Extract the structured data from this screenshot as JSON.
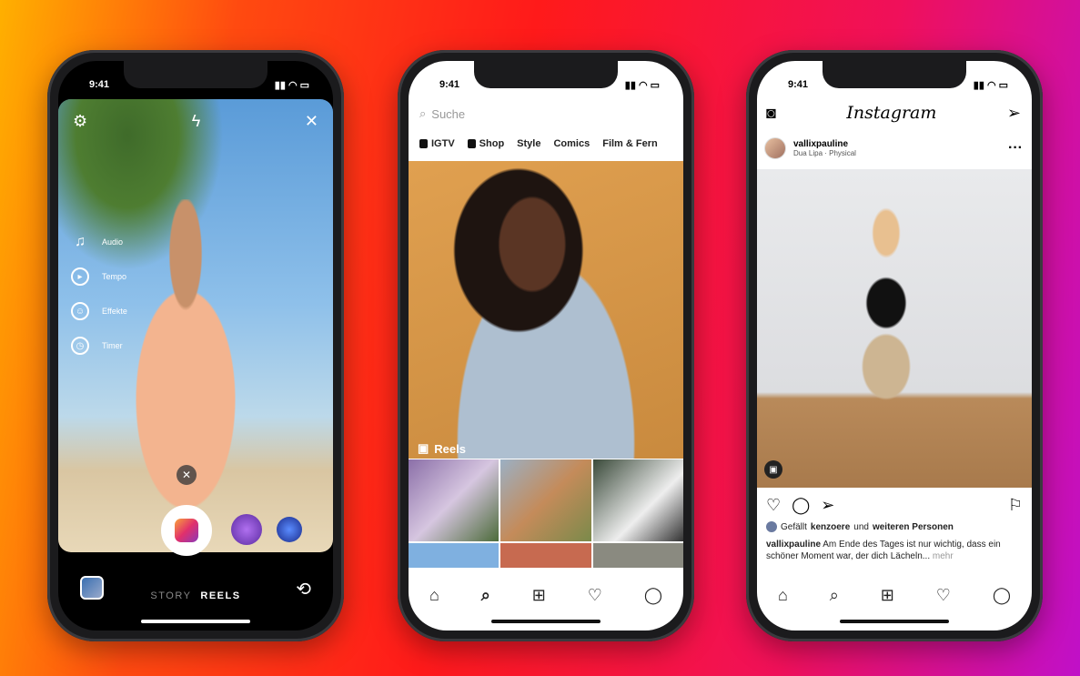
{
  "phones": [
    {
      "time": "9:41",
      "camera": {
        "tools": [
          {
            "icon": "music-note-icon",
            "label": "Audio"
          },
          {
            "icon": "speed-icon",
            "label": "Tempo"
          },
          {
            "icon": "face-effects-icon",
            "label": "Effekte"
          },
          {
            "icon": "timer-icon",
            "label": "Timer"
          }
        ],
        "modes": {
          "story": "STORY",
          "reels": "REELS",
          "active": "REELS"
        }
      }
    },
    {
      "time": "9:41",
      "search_placeholder": "Suche",
      "chips": [
        "IGTV",
        "Shop",
        "Style",
        "Comics",
        "Film & Fern"
      ],
      "reels_label": "Reels"
    },
    {
      "time": "9:41",
      "logo": "Instagram",
      "post": {
        "username": "vallixpauline",
        "audio": "Dua Lipa · Physical",
        "likes_prefix": "Gefällt",
        "likes_user": "kenzoere",
        "likes_mid": "und",
        "likes_suffix": "weiteren Personen",
        "caption_user": "vallixpauline",
        "caption": "Am Ende des Tages ist nur wichtig, dass ein schöner Moment war, der dich Lächeln...",
        "more": "mehr"
      }
    }
  ],
  "colors": {
    "background_start": "#ffb000",
    "background_end": "#c010c8"
  }
}
